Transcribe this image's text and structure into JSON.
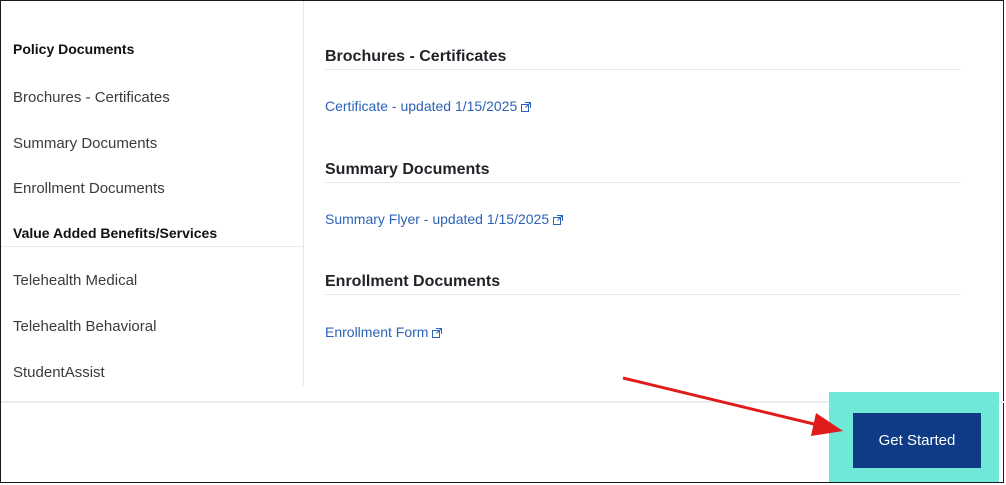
{
  "sidebar": {
    "items": [
      {
        "label": "Policy Documents",
        "type": "header"
      },
      {
        "label": "Brochures - Certificates",
        "type": "link"
      },
      {
        "label": "Summary Documents",
        "type": "link"
      },
      {
        "label": "Enrollment Documents",
        "type": "link"
      },
      {
        "label": "Value Added Benefits/Services",
        "type": "header"
      },
      {
        "label": "Telehealth Medical",
        "type": "link"
      },
      {
        "label": "Telehealth Behavioral",
        "type": "link"
      },
      {
        "label": "StudentAssist",
        "type": "link"
      }
    ]
  },
  "content": {
    "sections": [
      {
        "title": "Brochures - Certificates",
        "link": "Certificate - updated 1/15/2025"
      },
      {
        "title": "Summary Documents",
        "link": "Summary Flyer - updated 1/15/2025"
      },
      {
        "title": "Enrollment Documents",
        "link": "Enrollment Form"
      }
    ]
  },
  "footer": {
    "button_label": "Get Started"
  },
  "icons": {
    "link_icon": "external-link-icon"
  },
  "colors": {
    "link": "#2c63b8",
    "button_bg": "#0e3a86",
    "highlight": "#6fe8d8",
    "arrow": "#e01b1b"
  }
}
